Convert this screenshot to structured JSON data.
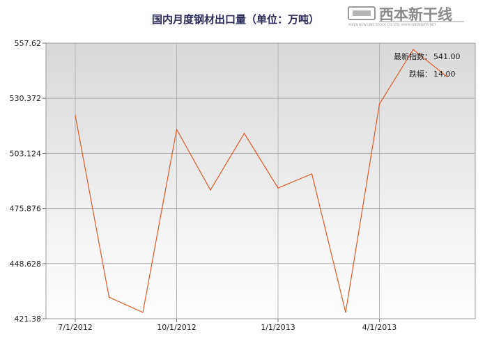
{
  "logo": {
    "brand": "西本新干线",
    "tagline": "XIBEN NEW LINE STOCK CO.,LTD.  WWW.XIBENDATA.NET"
  },
  "chart_data": {
    "type": "line",
    "title": "国内月度钢材出口量（单位：万吨）",
    "xlabel": "",
    "ylabel": "",
    "x": [
      "2012-07",
      "2012-08",
      "2012-09",
      "2012-10",
      "2012-11",
      "2012-12",
      "2013-01",
      "2013-02",
      "2013-03",
      "2013-04",
      "2013-05",
      "2013-06"
    ],
    "x_tick_labels": [
      "7/1/2012",
      "10/1/2012",
      "1/1/2013",
      "4/1/2013"
    ],
    "x_tick_positions": [
      0,
      3,
      6,
      9
    ],
    "y_ticks": [
      421.38,
      448.628,
      475.876,
      503.124,
      530.372,
      557.62
    ],
    "y_tick_labels": [
      "421.38",
      "448.628",
      "475.876",
      "503.124",
      "530.372",
      "557.62"
    ],
    "ylim": [
      421.38,
      557.62
    ],
    "values": [
      522,
      432,
      424.5,
      515,
      485,
      513,
      486,
      493,
      424.5,
      527.5,
      554.5,
      541
    ],
    "line_color": "#e05a2b",
    "grid": true,
    "annotations": [
      {
        "label": "最新指数：",
        "value": "541.00"
      },
      {
        "label": "跌幅：",
        "value": "14.00"
      }
    ]
  }
}
